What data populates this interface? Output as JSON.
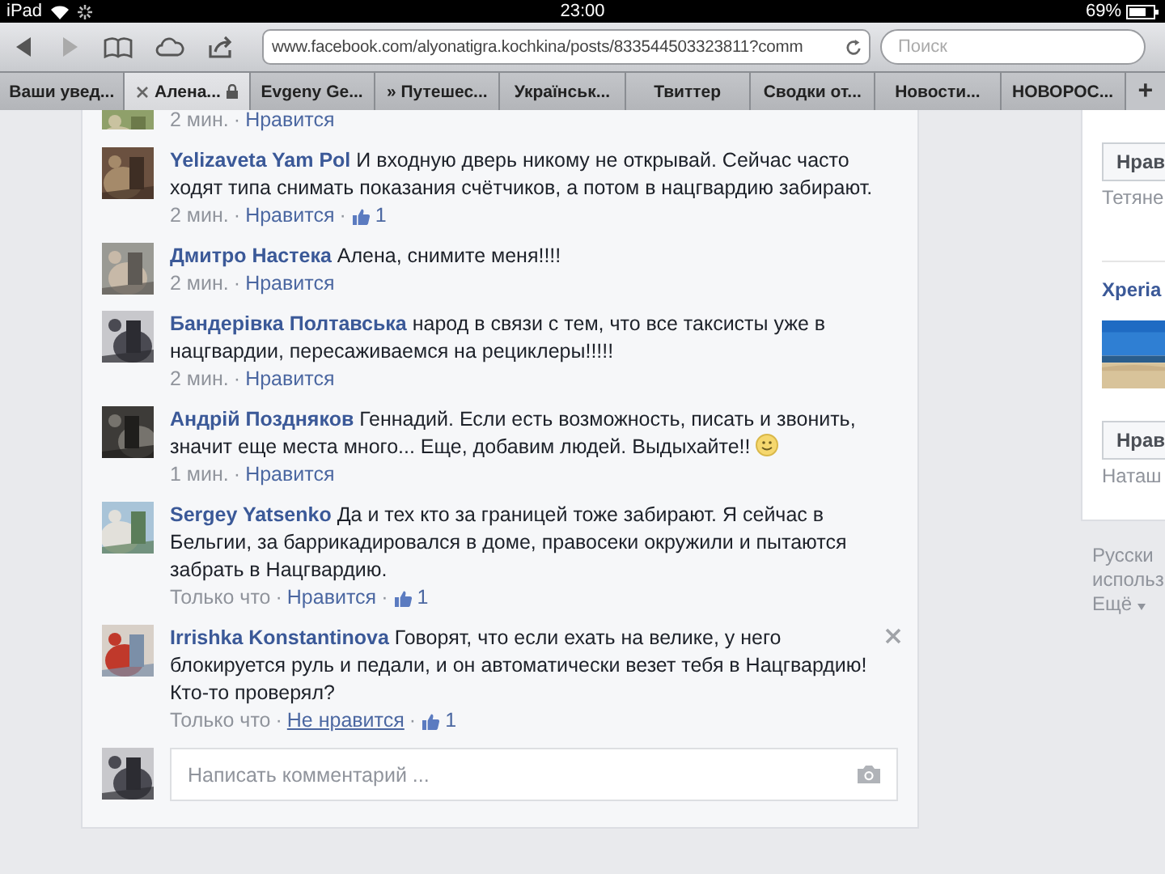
{
  "status_bar": {
    "device": "iPad",
    "time": "23:00",
    "battery": "69%"
  },
  "browser": {
    "url": "www.facebook.com/alyonatigra.kochkina/posts/833544503323811?comm",
    "search": {
      "placeholder": "Поиск"
    },
    "tabs": [
      {
        "label": "Ваши увед...",
        "selected": false,
        "closable": false
      },
      {
        "label": "Алена...",
        "selected": true,
        "closable": true
      },
      {
        "label": "Evgeny Ge...",
        "selected": false,
        "closable": false
      },
      {
        "label": "» Путешес...",
        "selected": false,
        "closable": false
      },
      {
        "label": "Українськ...",
        "selected": false,
        "closable": false
      },
      {
        "label": "Твиттер",
        "selected": false,
        "closable": false
      },
      {
        "label": "Сводки от...",
        "selected": false,
        "closable": false
      },
      {
        "label": "Новости...",
        "selected": false,
        "closable": false
      },
      {
        "label": "НОВОРОС...",
        "selected": false,
        "closable": false
      }
    ],
    "new_tab": "+"
  },
  "comments": [
    {
      "kind": "partial",
      "time": "2 мин.",
      "separators": [
        "·"
      ],
      "like_label": "Нравится",
      "liked": false
    },
    {
      "kind": "full",
      "author": "Yelizaveta Yam Pol",
      "text": "И входную дверь никому не открывай. Сейчас часто ходят типа снимать показания счётчиков, а потом в нацгвардию забирают.",
      "time": "2 мин.",
      "separators": [
        "·",
        "·"
      ],
      "like_label": "Нравится",
      "likes": "1",
      "liked": false,
      "smiley": false,
      "close_visible": false
    },
    {
      "kind": "full",
      "author": "Дмитро Настека",
      "text": "Алена, снимите меня!!!!",
      "time": "2 мин.",
      "separators": [
        "·"
      ],
      "like_label": "Нравится",
      "liked": false,
      "smiley": false,
      "close_visible": false
    },
    {
      "kind": "full",
      "author": "Бандерівка Полтавська",
      "text": "народ в связи с тем, что все таксисты уже в нацгвардии, пересаживаемся на рециклеры!!!!!",
      "time": "2 мин.",
      "separators": [
        "·"
      ],
      "like_label": "Нравится",
      "liked": false,
      "smiley": false,
      "close_visible": false
    },
    {
      "kind": "full",
      "author": "Андрій Поздняков",
      "text": "Геннадий. Если есть возможность, писать и звонить, значит еще места много... Еще, добавим людей. Выдыхайте!!",
      "time": "1 мин.",
      "separators": [
        "·"
      ],
      "like_label": "Нравится",
      "liked": false,
      "smiley": true,
      "close_visible": false
    },
    {
      "kind": "full",
      "author": "Sergey Yatsenko",
      "text": "Да и тех кто за границей тоже забирают. Я сейчас в Бельгии, за баррикадировался в доме, правосеки окружили и пытаются забрать в Нацгвардию.",
      "time": "Только что",
      "separators": [
        "·",
        "·"
      ],
      "like_label": "Нравится",
      "likes": "1",
      "liked": false,
      "smiley": false,
      "close_visible": false
    },
    {
      "kind": "full",
      "author": "Irrishka Konstantinova",
      "text": "Говорят, что если ехать на велике, у него блокируется руль и педали, и он автоматически везет тебя в Нацгвардию! Кто-то проверял?",
      "time": "Только что",
      "separators": [
        "·",
        "·"
      ],
      "like_label": "Не нравится",
      "likes": "1",
      "liked": true,
      "smiley": false,
      "close_visible": true
    }
  ],
  "composer": {
    "placeholder": "Написать комментарий ..."
  },
  "sidebar": {
    "items": [
      {
        "kind": "like_button",
        "label": "Нрав"
      },
      {
        "kind": "caption",
        "label": "Тетяне"
      },
      {
        "kind": "title",
        "label": "Xperia"
      },
      {
        "kind": "picture"
      },
      {
        "kind": "like_button",
        "label": "Нрав"
      },
      {
        "kind": "caption",
        "label": "Наташ"
      }
    ],
    "footer": {
      "lines": [
        "Русски",
        "использ"
      ],
      "more": "Ещё"
    }
  }
}
